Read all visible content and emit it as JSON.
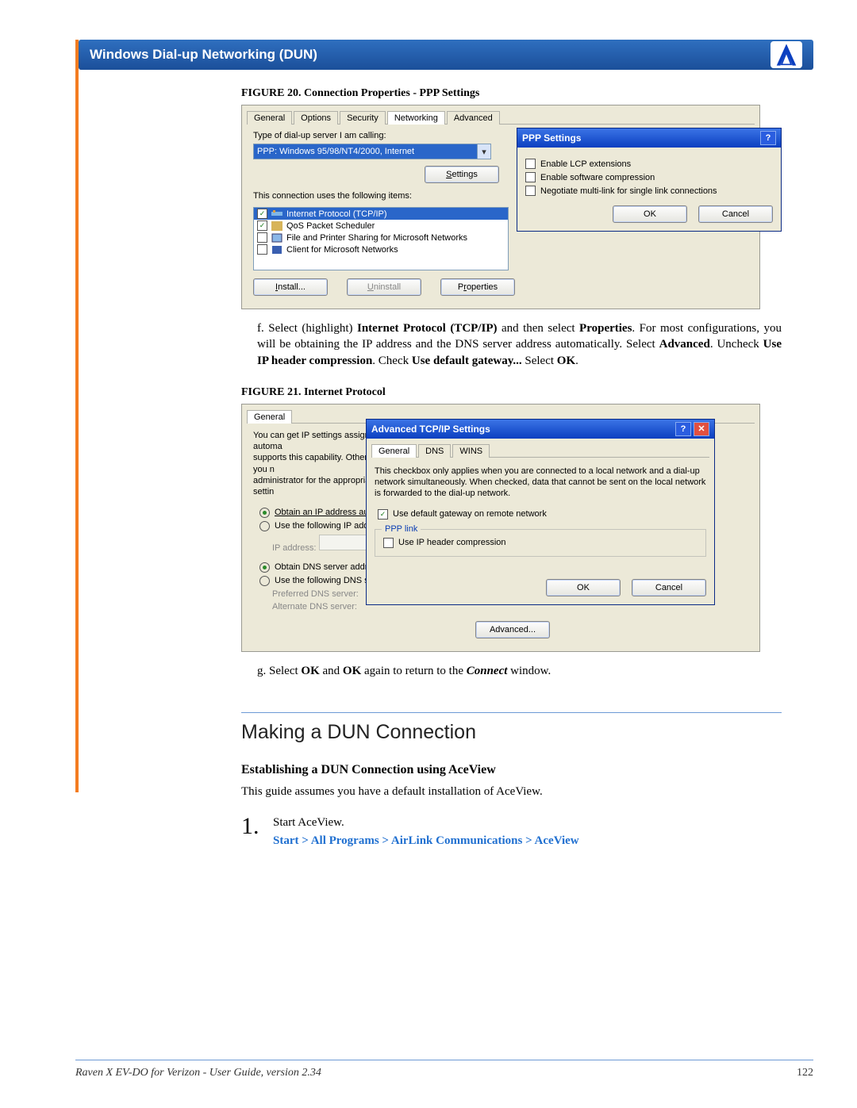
{
  "header": {
    "title": "Windows Dial-up Networking (DUN)"
  },
  "fig20": {
    "caption": "FIGURE 20.  Connection Properties - PPP Settings",
    "tabs": [
      "General",
      "Options",
      "Security",
      "Networking",
      "Advanced"
    ],
    "tab_selected": "Networking",
    "type_label": "Type of dial-up server I am calling:",
    "server_type": "PPP: Windows 95/98/NT4/2000, Internet",
    "settings_btn": "Settings",
    "uses_label": "This connection uses the following items:",
    "items": [
      {
        "label": "Internet Protocol (TCP/IP)",
        "checked": true,
        "selected": true
      },
      {
        "label": "QoS Packet Scheduler",
        "checked": true,
        "selected": false
      },
      {
        "label": "File and Printer Sharing for Microsoft Networks",
        "checked": false,
        "selected": false
      },
      {
        "label": "Client for Microsoft Networks",
        "checked": false,
        "selected": false
      }
    ],
    "install_btn": "Install...",
    "uninstall_btn": "Uninstall",
    "properties_btn": "Properties",
    "ppp": {
      "title": "PPP Settings",
      "opt1": "Enable LCP extensions",
      "opt2": "Enable software compression",
      "opt3": "Negotiate multi-link for single link connections",
      "ok": "OK",
      "cancel": "Cancel"
    }
  },
  "para_f": {
    "prefix": "f. Select (highlight) ",
    "b1": "Internet Protocol (TCP/IP)",
    "mid1": " and then select ",
    "b2": "Properties",
    "mid2": ". For most configurations, you will be obtaining the IP address and the DNS server address automatically.  Select ",
    "b3": "Advanced",
    "mid3": ".  Uncheck ",
    "b4": "Use IP header compression",
    "mid4": ". Check ",
    "b5": "Use default gateway...",
    "mid5": " Select ",
    "b6": "OK",
    "end": "."
  },
  "fig21": {
    "caption": "FIGURE 21.  Internet Protocol",
    "tab": "General",
    "blurb": "You can get IP settings assigned automatically if your network supports this capability. Otherwise, you need to ask your network administrator for the appropriate IP settings.",
    "r1": "Obtain an IP address automatically",
    "r2": "Use the following IP address:",
    "ip_label": "IP address:",
    "r3": "Obtain DNS server address automatically",
    "r4": "Use the following DNS server addresses:",
    "pref_dns": "Preferred DNS server:",
    "alt_dns": "Alternate DNS server:",
    "advanced_btn": "Advanced...",
    "adv": {
      "title": "Advanced TCP/IP Settings",
      "tabs": [
        "General",
        "DNS",
        "WINS"
      ],
      "blurb": "This checkbox only applies when you are connected to a local network and a dial-up network simultaneously.  When checked, data that cannot be sent on the local network is forwarded to the dial-up network.",
      "gw": "Use default gateway on remote network",
      "ppp_group": "PPP link",
      "ppp_opt": "Use IP header compression",
      "ok": "OK",
      "cancel": "Cancel"
    }
  },
  "para_g": {
    "prefix": "g. Select ",
    "b1": "OK",
    "mid1": " and ",
    "b2": "OK",
    "mid2": " again to return to the ",
    "i1": "Connect",
    "end": " window."
  },
  "section": {
    "title": "Making a DUN Connection",
    "sub": "Establishing a DUN Connection using AceView",
    "intro": "This guide assumes you have a default installation of AceView."
  },
  "step1": {
    "num": "1.",
    "line1": "Start AceView.",
    "cmd": "Start > All Programs > AirLink Communications > AceView"
  },
  "footer": {
    "text": "Raven X EV-DO for Verizon - User Guide, version 2.34",
    "page": "122"
  }
}
